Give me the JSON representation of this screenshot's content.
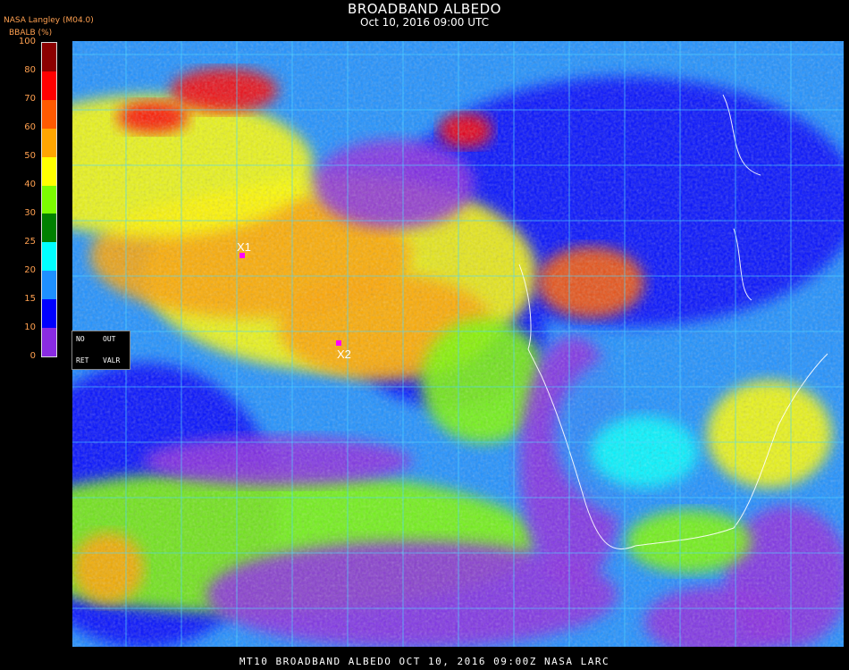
{
  "header": {
    "title": "BROADBAND ALBEDO",
    "subtitle": "Oct 10, 2016 09:00 UTC",
    "source": "NASA Langley (M04.0)",
    "unit_label": "BBALB (%)"
  },
  "legend": {
    "ticks": [
      "100",
      "80",
      "70",
      "60",
      "50",
      "40",
      "30",
      "25",
      "20",
      "15",
      "10",
      "0"
    ],
    "colors": [
      "#8a2be2",
      "#0000ff",
      "#1e90ff",
      "#00ffff",
      "#008000",
      "#7cfc00",
      "#ffff00",
      "#ffa500",
      "#ff5a00",
      "#ff0000",
      "#8b0000"
    ]
  },
  "panel": {
    "no": "NO",
    "out": "OUT",
    "ret": "RET",
    "valr": "VALR"
  },
  "markers": [
    {
      "label": "X1",
      "color": "#ff00ff"
    },
    {
      "label": "X2",
      "color": "#ff00ff"
    }
  ],
  "grid": {
    "color": "#4fd6ff"
  },
  "footer": "MT10  BROADBAND ALBEDO   OCT 10, 2016 09:00Z   NASA LARC"
}
